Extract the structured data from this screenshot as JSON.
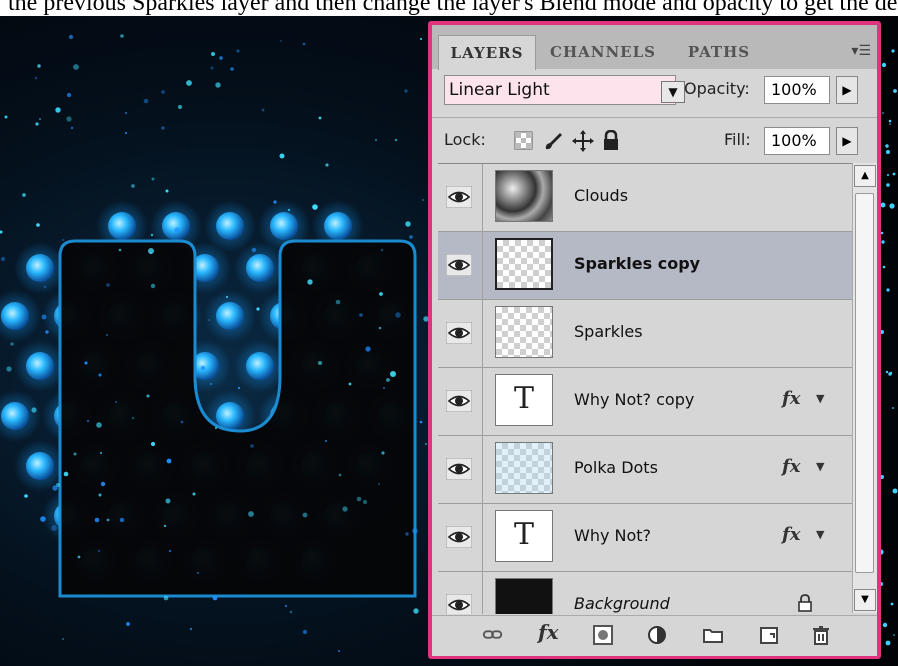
{
  "caption": "the previous Sparkles layer and then change the layer's Blend mode and opacity to get the desired sparkling effect.",
  "panel": {
    "tabs": [
      {
        "label": "LAYERS",
        "active": true
      },
      {
        "label": "CHANNELS",
        "active": false
      },
      {
        "label": "PATHS",
        "active": false
      }
    ],
    "menu_icon": "panel-menu-icon",
    "blend_mode": "Linear Light",
    "opacity_label": "Opacity:",
    "opacity_value": "100%",
    "lock_label": "Lock:",
    "fill_label": "Fill:",
    "fill_value": "100%",
    "layers": [
      {
        "name": "Clouds",
        "thumb": "clouds",
        "selected": false,
        "fx": false,
        "locked": false,
        "style": "normal"
      },
      {
        "name": "Sparkles copy",
        "thumb": "checker",
        "selected": true,
        "fx": false,
        "locked": false,
        "style": "bold"
      },
      {
        "name": "Sparkles",
        "thumb": "checker",
        "selected": false,
        "fx": false,
        "locked": false,
        "style": "normal"
      },
      {
        "name": "Why Not? copy",
        "thumb": "text",
        "selected": false,
        "fx": true,
        "locked": false,
        "style": "normal"
      },
      {
        "name": "Polka Dots",
        "thumb": "dots",
        "selected": false,
        "fx": true,
        "locked": false,
        "style": "normal"
      },
      {
        "name": "Why Not?",
        "thumb": "text",
        "selected": false,
        "fx": true,
        "locked": false,
        "style": "normal"
      },
      {
        "name": "Background",
        "thumb": "black",
        "selected": false,
        "fx": false,
        "locked": true,
        "style": "italic"
      }
    ],
    "fx_label": "fx",
    "text_thumb_glyph": "T",
    "footer_icons": [
      "link-layers-icon",
      "add-layer-style-icon",
      "add-mask-icon",
      "new-adjustment-layer-icon",
      "new-group-icon",
      "new-layer-icon",
      "delete-layer-icon"
    ]
  },
  "colors": {
    "panel_border": "#e0347f",
    "selected_row": "#b5b8c5",
    "glow": "#2ab8ff"
  }
}
